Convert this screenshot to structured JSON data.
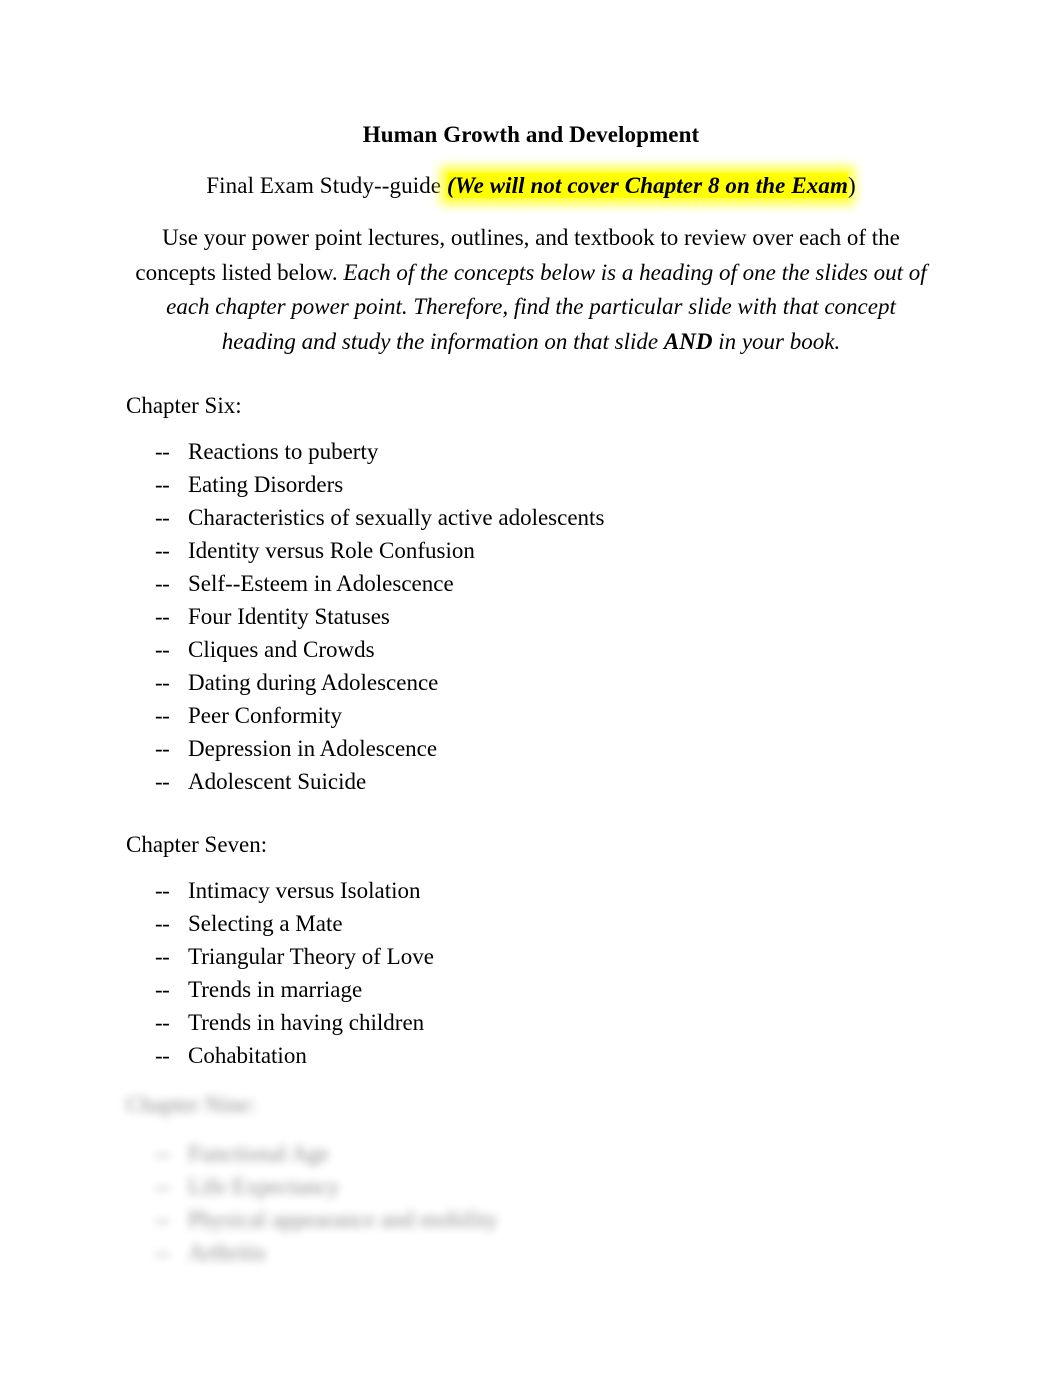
{
  "document": {
    "title": "Human Growth and Development",
    "subtitle": {
      "prefix": "Final Exam Study--guide ",
      "open_paren": "(",
      "highlighted": "We will not cover Chapter 8 on the Exam",
      "close_paren": ")",
      "highlight_color": "#ffff00"
    },
    "intro": {
      "plain_part": "Use your power point lectures, outlines, and textbook to review over each of the concepts listed below. ",
      "italic_part_1": "Each of the concepts below is a heading of one the slides out of each chapter power point. Therefore, find the particular slide with that concept heading and study the information on that slide ",
      "bold_italic_and": "AND",
      "italic_part_2": " in your book."
    },
    "sections": [
      {
        "heading": "Chapter Six:",
        "marker": "--",
        "items": [
          "Reactions to puberty",
          "Eating Disorders",
          "Characteristics of sexually active adolescents",
          "Identity versus Role Confusion",
          "Self--Esteem in Adolescence",
          "Four Identity Statuses",
          "Cliques and Crowds",
          "Dating during Adolescence",
          "Peer Conformity",
          "Depression in Adolescence",
          "Adolescent Suicide"
        ]
      },
      {
        "heading": "Chapter Seven:",
        "marker": "--",
        "items": [
          "Intimacy versus Isolation",
          "Selecting a Mate",
          "Triangular Theory of Love",
          "Trends in marriage",
          "Trends in having children",
          "Cohabitation"
        ]
      },
      {
        "heading": "Chapter Nine:",
        "marker": "--",
        "blurred": true,
        "items": [
          "Functional Age",
          "Life Expectancy",
          "Physical appearance and mobility",
          "Arthritis"
        ]
      }
    ]
  }
}
